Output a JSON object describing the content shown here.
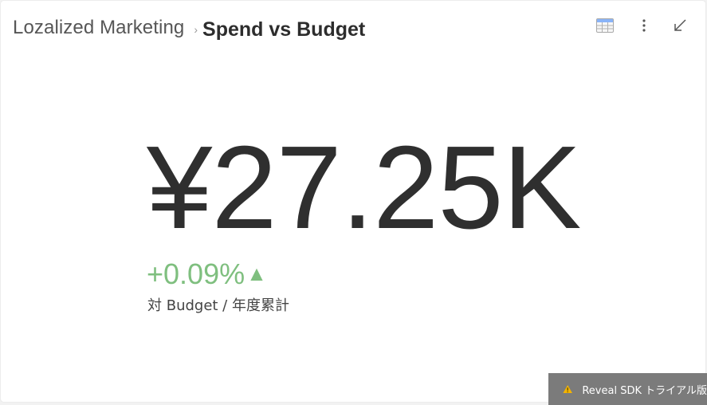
{
  "header": {
    "parent_title": "Lozalized Marketing",
    "separator": "›",
    "title": "Spend vs Budget"
  },
  "toolbar": {
    "icons": [
      "grid-view-icon",
      "more-vert-icon",
      "minimize-icon"
    ]
  },
  "kpi": {
    "value": "¥27.25K",
    "change": "+0.09%",
    "change_arrow": "▲",
    "comparison_label": "対 Budget / 年度累計"
  },
  "trial_banner": {
    "label": "Reveal SDK トライアル版"
  },
  "colors": {
    "positive": "#7fbf7f",
    "banner_bg": "#7b7b7b",
    "warning": "#f4b400",
    "grid_icon_accent": "#8ab4f8"
  }
}
